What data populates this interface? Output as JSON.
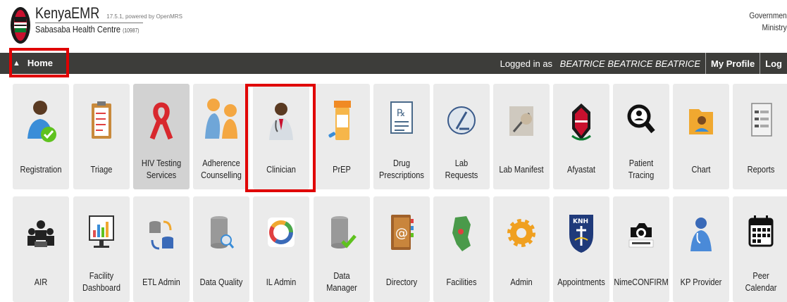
{
  "header": {
    "brand_name": "KenyaEMR",
    "version": "17.5.1, powered by OpenMRS",
    "facility": "Sabasaba Health Centre",
    "facility_code": "(10987)",
    "gov_line1": "Governmen",
    "gov_line2": "Ministry"
  },
  "topnav": {
    "home_label": "Home",
    "logged_prefix": "Logged in as",
    "user": "BEATRICE BEATRICE BEATRICE",
    "my_profile": "My Profile",
    "logout": "Log"
  },
  "apps_row1": [
    {
      "label": "Registration",
      "icon": "registration-icon"
    },
    {
      "label": "Triage",
      "icon": "clipboard-icon"
    },
    {
      "label": "HIV Testing Services",
      "icon": "ribbon-icon"
    },
    {
      "label": "Adherence Counselling",
      "icon": "counselling-icon"
    },
    {
      "label": "Clinician",
      "icon": "doctor-icon"
    },
    {
      "label": "PrEP",
      "icon": "pill-bottle-icon"
    },
    {
      "label": "Drug Prescriptions",
      "icon": "prescription-icon"
    },
    {
      "label": "Lab Requests",
      "icon": "microscope-icon"
    },
    {
      "label": "Lab Manifest",
      "icon": "manifest-icon"
    },
    {
      "label": "Afyastat",
      "icon": "shield-icon"
    },
    {
      "label": "Patient Tracing",
      "icon": "tracing-icon"
    },
    {
      "label": "Chart",
      "icon": "folder-icon"
    },
    {
      "label": "Reports",
      "icon": "report-icon"
    }
  ],
  "apps_row2": [
    {
      "label": "AIR",
      "icon": "meeting-icon"
    },
    {
      "label": "Facility Dashboard",
      "icon": "dashboard-icon"
    },
    {
      "label": "ETL Admin",
      "icon": "etl-icon"
    },
    {
      "label": "Data Quality",
      "icon": "database-search-icon"
    },
    {
      "label": "IL Admin",
      "icon": "il-icon"
    },
    {
      "label": "Data Manager",
      "icon": "database-check-icon"
    },
    {
      "label": "Directory",
      "icon": "address-book-icon"
    },
    {
      "label": "Facilities",
      "icon": "map-icon"
    },
    {
      "label": "Admin",
      "icon": "gear-icon"
    },
    {
      "label": "Appointments",
      "icon": "knh-crest-icon"
    },
    {
      "label": "NimeCONFIRM",
      "icon": "camera-icon"
    },
    {
      "label": "KP Provider",
      "icon": "provider-icon"
    },
    {
      "label": "Peer Calendar",
      "icon": "calendar-icon"
    }
  ],
  "colors": {
    "highlight": "#e00000",
    "navbar": "#3d3d3a",
    "tile": "#ebebeb"
  }
}
